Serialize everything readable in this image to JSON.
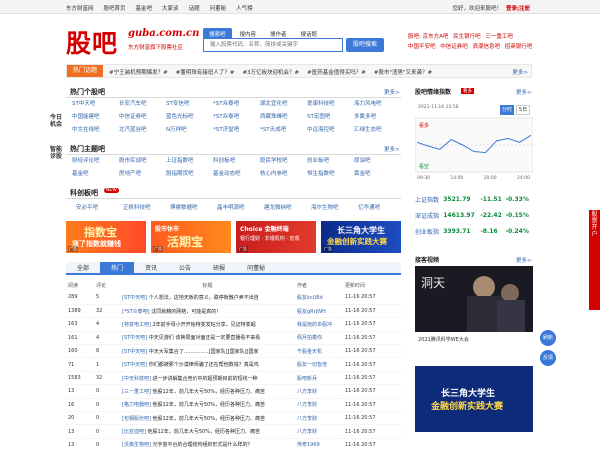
{
  "topbar": {
    "left_links": [
      "东方财富网",
      "股吧首页",
      "基金吧",
      "大家谈",
      "话题",
      "问董秘",
      "人气榜"
    ],
    "greeting": "您好，欢迎来股吧！",
    "login": "登录|注册"
  },
  "logo": {
    "mark": "股吧",
    "domain": "guba.com.cn",
    "slogan": "东方财富旗下股票社区"
  },
  "search": {
    "tabs": [
      "搜索吧",
      "搜内容",
      "搜作者",
      "搜话题"
    ],
    "active_tab": 0,
    "placeholder": "输入股票代码、名称、简拼或关键字",
    "button": "股吧搜索"
  },
  "hot_links": [
    "股吧: 京东方A吧",
    "民生银行吧",
    "三一重工吧",
    "中国平安吧",
    "中信证券吧",
    "浪潮信息吧",
    "招商银行吧"
  ],
  "topics": {
    "label": "热门话题",
    "items": [
      "#宁王装机预期爆发？#",
      "#董明珠有接班人了？#",
      "#3万亿板块迎机会？#",
      "#医药基金值得买吗？#",
      "#股市\"渣男\"又来袭？#"
    ],
    "more": "更多>"
  },
  "side_tabs": [
    "今日机会",
    "智能诊股"
  ],
  "popular_bars": {
    "title": "热门个股吧",
    "more": "更多>",
    "items": [
      "ST中天吧",
      "长安汽车吧",
      "ST安信吧",
      "*ST众泰吧",
      "湖北宜化吧",
      "爱康科技吧",
      "海力风电吧",
      "中国能建吧",
      "中信证券吧",
      "蓝色光标吧",
      "*ST众泰吧",
      "西藏珠峰吧",
      "ST宏图吧",
      "多氟多吧",
      "中文在线吧",
      "北汽蓝谷吧",
      "N万祥吧",
      "*ST济堂吧",
      "*ST天成吧",
      "中远海控吧",
      "汇绿生态吧"
    ]
  },
  "theme_bars": {
    "title": "热门主题吧",
    "more": "更多>",
    "items": [
      "财经评论吧",
      "股市实战吧",
      "上证指数吧",
      "科创板吧",
      "股民学校吧",
      "创业板吧",
      "原油吧",
      "基金吧",
      "房地产吧",
      "股指期货吧",
      "基金动态吧",
      "核心内参吧",
      "恒生指数吧",
      "黄金吧"
    ]
  },
  "star_market": {
    "title": "科创板吧",
    "badge": "NEW",
    "items": [
      "安必平吧",
      "正帆科技吧",
      "博睿数据吧",
      "晶丰明源吧",
      "建龙微纳吧",
      "海尔生物吧",
      "亿华通吧"
    ]
  },
  "banners": [
    {
      "line1": "指数宝",
      "line2": "涨了指数就赚钱",
      "tag": "广告"
    },
    {
      "line1": "股市休市",
      "line2": "活期宝",
      "tag": "广告"
    },
    {
      "line1": "Choice 金融终端",
      "line2": "银行理财 · 非银机构 · 宏观",
      "tag": "广告"
    },
    {
      "line1": "长三角大学生",
      "line2": "金融创新实践大赛",
      "tag": "广告"
    }
  ],
  "feed": {
    "tabs": [
      "全部",
      "热门",
      "资讯",
      "公告",
      "研报",
      "问董秘"
    ],
    "active_tab": 1,
    "headers": [
      "阅读",
      "评论",
      "标题",
      "作者",
      "更新时间"
    ],
    "rows": [
      {
        "read": "289",
        "comments": "5",
        "tag": "[ST中天吧]",
        "title": "个人想法，这地天板的意义，跌停板散户卖不出自",
        "author": "股友kcU8d",
        "time": "11-16 20:57"
      },
      {
        "read": "1389",
        "comments": "32",
        "tag": "[*ST众泰吧]",
        "title": "沈同就精的网络，可能是真的！",
        "author": "股友gRrjWH",
        "time": "11-16 20:57"
      },
      {
        "read": "163",
        "comments": "4",
        "tag": "[特变电工吧]",
        "title": "2年前手母小开开始特变发帖分享，见证特变崛",
        "author": "我是她的多假冲",
        "time": "11-16 20:57"
      },
      {
        "read": "161",
        "comments": "4",
        "tag": "[ST中天吧]",
        "title": "中天见游们 该换局面对面还是一定要直播看不来看",
        "author": "佩月拍着你",
        "time": "11-16 20:57"
      },
      {
        "read": "160",
        "comments": "8",
        "tag": "[ST中天吧]",
        "title": "中天大军集合了……………[国家队][国家队][国家",
        "author": "千股金天机",
        "time": "11-16 20:57"
      },
      {
        "read": "71",
        "comments": "1",
        "tag": "[ST中天吧]",
        "title": "你们都被那个沙漠律师骗了还在帮他数钱？真是鸡",
        "author": "股友一切皆倍",
        "time": "11-16 20:57"
      },
      {
        "read": "1583",
        "comments": "32",
        "tag": "[中天科技吧]",
        "title": "进一步讲解集合竞价中的超预期目前的短线一种",
        "author": "股吧新兵",
        "time": "11-16 20:57"
      },
      {
        "read": "13",
        "comments": "0",
        "tag": "[三一重工吧]",
        "title": "他股12年，前几年大亏50%，经历各种压力、痛苦",
        "author": "八方李财",
        "time": "11-16 20:57"
      },
      {
        "read": "16",
        "comments": "0",
        "tag": "[格力电器吧]",
        "title": "他股12年，前几年大亏50%，经历各种压力、痛苦",
        "author": "八方李财",
        "time": "11-16 20:57"
      },
      {
        "read": "20",
        "comments": "0",
        "tag": "[包钢股份吧]",
        "title": "他股12年，前几年大亏50%，经历各种压力、痛苦",
        "author": "八方李财",
        "time": "11-16 20:57"
      },
      {
        "read": "13",
        "comments": "0",
        "tag": "[比亚迪吧]",
        "title": "他股12年，前几年大亏50%，经历各种压力、痛苦",
        "author": "八方李财",
        "time": "11-16 20:57"
      },
      {
        "read": "13",
        "comments": "0",
        "tag": "[沃森生物吧]",
        "title": "元宇宙平台的合理结构组织形式是什么样的？",
        "author": "传奇1969",
        "time": "11-16 20:57"
      }
    ]
  },
  "index_panel": {
    "title": "股吧情绪指数",
    "badge": "看多",
    "more": "更多>",
    "datetime": "2021-11-16 12:58",
    "chart_tabs": [
      "分时",
      "5日"
    ],
    "active_chart_tab": 0,
    "bull_label": "看多",
    "bear_label": "看空",
    "time_labels": [
      "09:30",
      "14:00",
      "20:00",
      "24:00"
    ],
    "colors": {
      "up": "#d40000",
      "down": "#0a8a3c",
      "line": "#3a79d8"
    },
    "chart_data": {
      "type": "line",
      "x": [
        "09:30",
        "14:00",
        "20:00",
        "24:00"
      ],
      "series": [
        {
          "name": "",
          "values": [
            0.55,
            0.48,
            0.42,
            0.6,
            0.5,
            0.38,
            0.36,
            0.58,
            0.62,
            0.55,
            0.68
          ]
        }
      ]
    }
  },
  "indices": [
    {
      "name": "上证指数",
      "value": "3521.79",
      "change": "-11.51",
      "pct": "-0.33%",
      "dir": "dn"
    },
    {
      "name": "深证成指",
      "value": "14613.97",
      "change": "-22.42",
      "pct": "-0.15%",
      "dir": "dn"
    },
    {
      "name": "创业板指",
      "value": "3393.71",
      "change": "-8.16",
      "pct": "-0.24%",
      "dir": "dn"
    }
  ],
  "video": {
    "title": "接客视频",
    "more": "更多>",
    "caption1": "洞天",
    "caption2": "2021腾讯科学WE大会",
    "promo1": "长三角大学生",
    "promo2": "金融创新实践大赛"
  },
  "float": {
    "side": "股票开户",
    "refresh": "刷新",
    "feedback": "反馈"
  }
}
